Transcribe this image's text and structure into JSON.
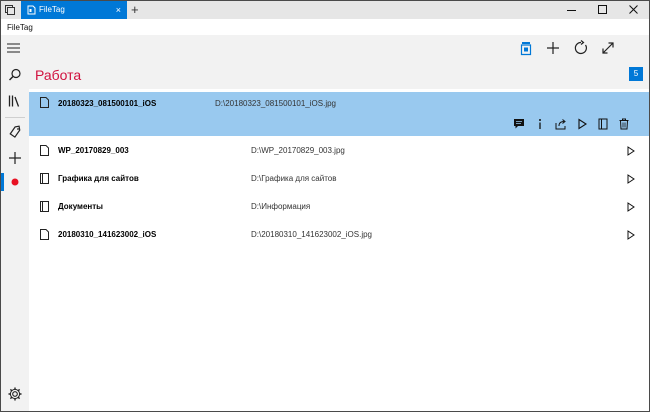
{
  "window": {
    "tab_title": "FileTag",
    "tab_close": "×",
    "new_tab": "+",
    "app_name": "FileTag"
  },
  "header": {
    "title": "Работа",
    "count": "5"
  },
  "icons": {
    "toolbar": [
      "menu-icon",
      "tag-jar-icon",
      "add-icon",
      "refresh-icon",
      "expand-icon"
    ],
    "nav": [
      "search-icon",
      "library-icon",
      "tag-icon",
      "add-icon",
      "record-dot-icon",
      "settings-icon"
    ],
    "actions": [
      "comment-icon",
      "info-icon",
      "share-icon",
      "play-icon",
      "book-icon",
      "delete-icon"
    ]
  },
  "colors": {
    "accent": "#0078d7",
    "title_red": "#d1123f",
    "selection": "#99c9ef",
    "record_dot": "#e81123"
  },
  "files": [
    {
      "name": "20180323_081500101_iOS",
      "path": "D:\\20180323_081500101_iOS.jpg",
      "type": "file",
      "selected": true
    },
    {
      "name": "WP_20170829_003",
      "path": "D:\\WP_20170829_003.jpg",
      "type": "file",
      "selected": false
    },
    {
      "name": "Графика для сайтов",
      "path": "D:\\Графика для сайтов",
      "type": "folder",
      "selected": false
    },
    {
      "name": "Документы",
      "path": "D:\\Информация",
      "type": "folder",
      "selected": false
    },
    {
      "name": "20180310_141623002_iOS",
      "path": "D:\\20180310_141623002_iOS.jpg",
      "type": "file",
      "selected": false
    }
  ]
}
